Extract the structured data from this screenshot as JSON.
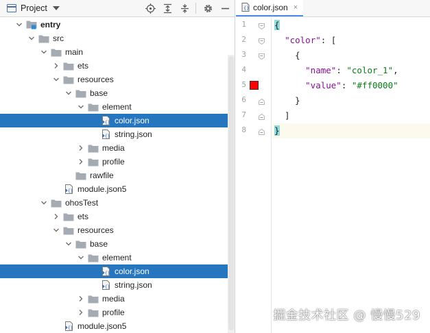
{
  "panel": {
    "title": "Project",
    "tools": [
      "locate-icon",
      "expand-all-icon",
      "collapse-all-icon",
      "gear-icon",
      "minimize-icon"
    ]
  },
  "tree": [
    {
      "label": "entry",
      "depth": 0,
      "arrow": "down",
      "icon": "module-folder",
      "bold": true,
      "selected": false
    },
    {
      "label": "src",
      "depth": 1,
      "arrow": "down",
      "icon": "folder",
      "bold": false,
      "selected": false
    },
    {
      "label": "main",
      "depth": 2,
      "arrow": "down",
      "icon": "folder",
      "bold": false,
      "selected": false
    },
    {
      "label": "ets",
      "depth": 3,
      "arrow": "right",
      "icon": "folder",
      "bold": false,
      "selected": false
    },
    {
      "label": "resources",
      "depth": 3,
      "arrow": "down",
      "icon": "folder",
      "bold": false,
      "selected": false
    },
    {
      "label": "base",
      "depth": 4,
      "arrow": "down",
      "icon": "folder",
      "bold": false,
      "selected": false
    },
    {
      "label": "element",
      "depth": 5,
      "arrow": "down",
      "icon": "folder",
      "bold": false,
      "selected": false
    },
    {
      "label": "color.json",
      "depth": 6,
      "arrow": "none",
      "icon": "json-file",
      "bold": false,
      "selected": true
    },
    {
      "label": "string.json",
      "depth": 6,
      "arrow": "none",
      "icon": "json-file",
      "bold": false,
      "selected": false
    },
    {
      "label": "media",
      "depth": 5,
      "arrow": "right",
      "icon": "folder",
      "bold": false,
      "selected": false
    },
    {
      "label": "profile",
      "depth": 5,
      "arrow": "right",
      "icon": "folder",
      "bold": false,
      "selected": false
    },
    {
      "label": "rawfile",
      "depth": 4,
      "arrow": "none",
      "icon": "folder",
      "bold": false,
      "selected": false
    },
    {
      "label": "module.json5",
      "depth": 3,
      "arrow": "none",
      "icon": "json-file",
      "bold": false,
      "selected": false
    },
    {
      "label": "ohosTest",
      "depth": 2,
      "arrow": "down",
      "icon": "folder",
      "bold": false,
      "selected": false
    },
    {
      "label": "ets",
      "depth": 3,
      "arrow": "right",
      "icon": "folder",
      "bold": false,
      "selected": false
    },
    {
      "label": "resources",
      "depth": 3,
      "arrow": "down",
      "icon": "folder",
      "bold": false,
      "selected": false
    },
    {
      "label": "base",
      "depth": 4,
      "arrow": "down",
      "icon": "folder",
      "bold": false,
      "selected": false
    },
    {
      "label": "element",
      "depth": 5,
      "arrow": "down",
      "icon": "folder",
      "bold": false,
      "selected": false
    },
    {
      "label": "color.json",
      "depth": 6,
      "arrow": "none",
      "icon": "json-file",
      "bold": false,
      "selected": true
    },
    {
      "label": "string.json",
      "depth": 6,
      "arrow": "none",
      "icon": "json-file",
      "bold": false,
      "selected": false
    },
    {
      "label": "media",
      "depth": 5,
      "arrow": "right",
      "icon": "folder",
      "bold": false,
      "selected": false
    },
    {
      "label": "profile",
      "depth": 5,
      "arrow": "right",
      "icon": "folder",
      "bold": false,
      "selected": false
    },
    {
      "label": "module.json5",
      "depth": 3,
      "arrow": "none",
      "icon": "json-file",
      "bold": false,
      "selected": false
    }
  ],
  "editor": {
    "tab": {
      "label": "color.json",
      "close": "×"
    },
    "lines": [
      {
        "n": "1",
        "fold": "open",
        "tokens": [
          {
            "t": "{",
            "c": "brace"
          }
        ]
      },
      {
        "n": "2",
        "fold": "open",
        "tokens": [
          {
            "t": "  ",
            "c": "p"
          },
          {
            "t": "\"color\"",
            "c": "k"
          },
          {
            "t": ": [",
            "c": "p"
          }
        ]
      },
      {
        "n": "3",
        "fold": "open",
        "tokens": [
          {
            "t": "    {",
            "c": "p"
          }
        ]
      },
      {
        "n": "4",
        "fold": "",
        "tokens": [
          {
            "t": "      ",
            "c": "p"
          },
          {
            "t": "\"name\"",
            "c": "k"
          },
          {
            "t": ": ",
            "c": "p"
          },
          {
            "t": "\"color_1\"",
            "c": "s"
          },
          {
            "t": ",",
            "c": "p"
          }
        ]
      },
      {
        "n": "5",
        "fold": "",
        "swatch": "#ff0000",
        "tokens": [
          {
            "t": "      ",
            "c": "p"
          },
          {
            "t": "\"value\"",
            "c": "k"
          },
          {
            "t": ": ",
            "c": "p"
          },
          {
            "t": "\"#ff0000\"",
            "c": "s"
          }
        ]
      },
      {
        "n": "6",
        "fold": "close",
        "tokens": [
          {
            "t": "    }",
            "c": "p"
          }
        ]
      },
      {
        "n": "7",
        "fold": "close",
        "tokens": [
          {
            "t": "  ]",
            "c": "p"
          }
        ]
      },
      {
        "n": "8",
        "fold": "close",
        "current": true,
        "tokens": [
          {
            "t": "}",
            "c": "brace"
          }
        ]
      }
    ]
  },
  "watermark": "掘金技术社区 @ 慢慢529",
  "colors": {
    "selection": "#2675bf",
    "key": "#871094",
    "string": "#067d17",
    "swatch": "#ff0000",
    "brace_match": "#93d9d9"
  }
}
